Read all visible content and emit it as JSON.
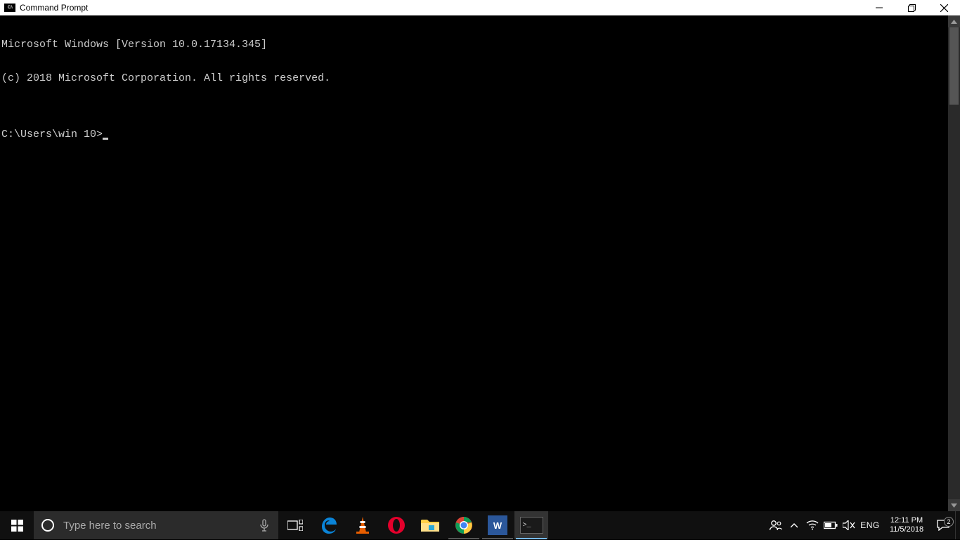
{
  "window": {
    "title": "Command Prompt",
    "app_icon_label": "C:\\"
  },
  "terminal": {
    "line1": "Microsoft Windows [Version 10.0.17134.345]",
    "line2": "(c) 2018 Microsoft Corporation. All rights reserved.",
    "blank": "",
    "prompt": "C:\\Users\\win 10>"
  },
  "taskbar": {
    "search_placeholder": "Type here to search",
    "lang": "ENG",
    "time": "12:11 PM",
    "date": "11/5/2018",
    "notification_count": "2"
  }
}
